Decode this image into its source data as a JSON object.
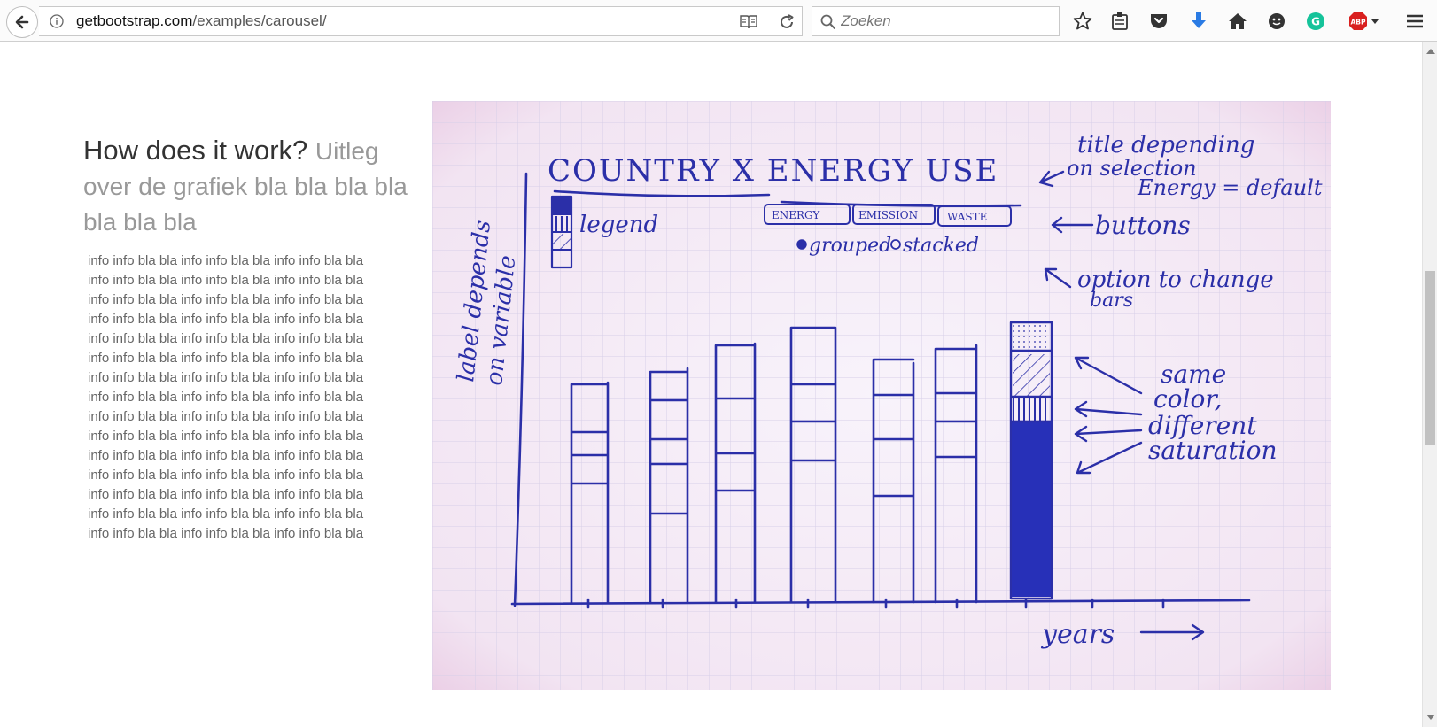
{
  "browser": {
    "url_domain": "getbootstrap.com",
    "url_path": "/examples/carousel/",
    "search_placeholder": "Zoeken"
  },
  "content": {
    "heading_main": "How does it work?",
    "heading_sub": "Uitleg over de grafiek bla bla bla bla bla bla bla",
    "body": "info info bla bla info info bla bla info info bla bla info info bla bla info info bla bla info info bla bla info info bla bla info info bla bla info info bla bla info info bla bla info info bla bla info info bla bla info info bla bla info info bla bla info info bla bla info info bla bla info info bla bla info info bla bla info info bla bla info info bla bla info info bla bla info info bla bla info info bla bla info info bla bla info info bla bla info info bla bla info info bla bla info info bla bla info info bla bla info info bla bla info info bla bla info info bla bla info info bla bla info info bla bla info info bla bla info info bla bla info info bla bla info info bla bla info info bla bla info info bla bla info info bla bla info info bla bla info info bla bla info info bla bla info info bla bla"
  },
  "sketch": {
    "title": "COUNTRY X ENERGY USE",
    "legend_label": "legend",
    "buttons": [
      "ENERGY",
      "EMISSION",
      "WASTE"
    ],
    "radio_options": [
      "grouped",
      "stacked"
    ],
    "y_label_line1": "label depends",
    "y_label_line2": "on variable",
    "x_label": "years",
    "note_title": [
      "title depending",
      "on selection",
      "Energy = default"
    ],
    "note_buttons": "buttons",
    "note_option": [
      "option to change",
      "bars"
    ],
    "note_color": [
      "same",
      "color,",
      "different",
      "saturation"
    ],
    "ink_color": "#2b2fa8"
  }
}
